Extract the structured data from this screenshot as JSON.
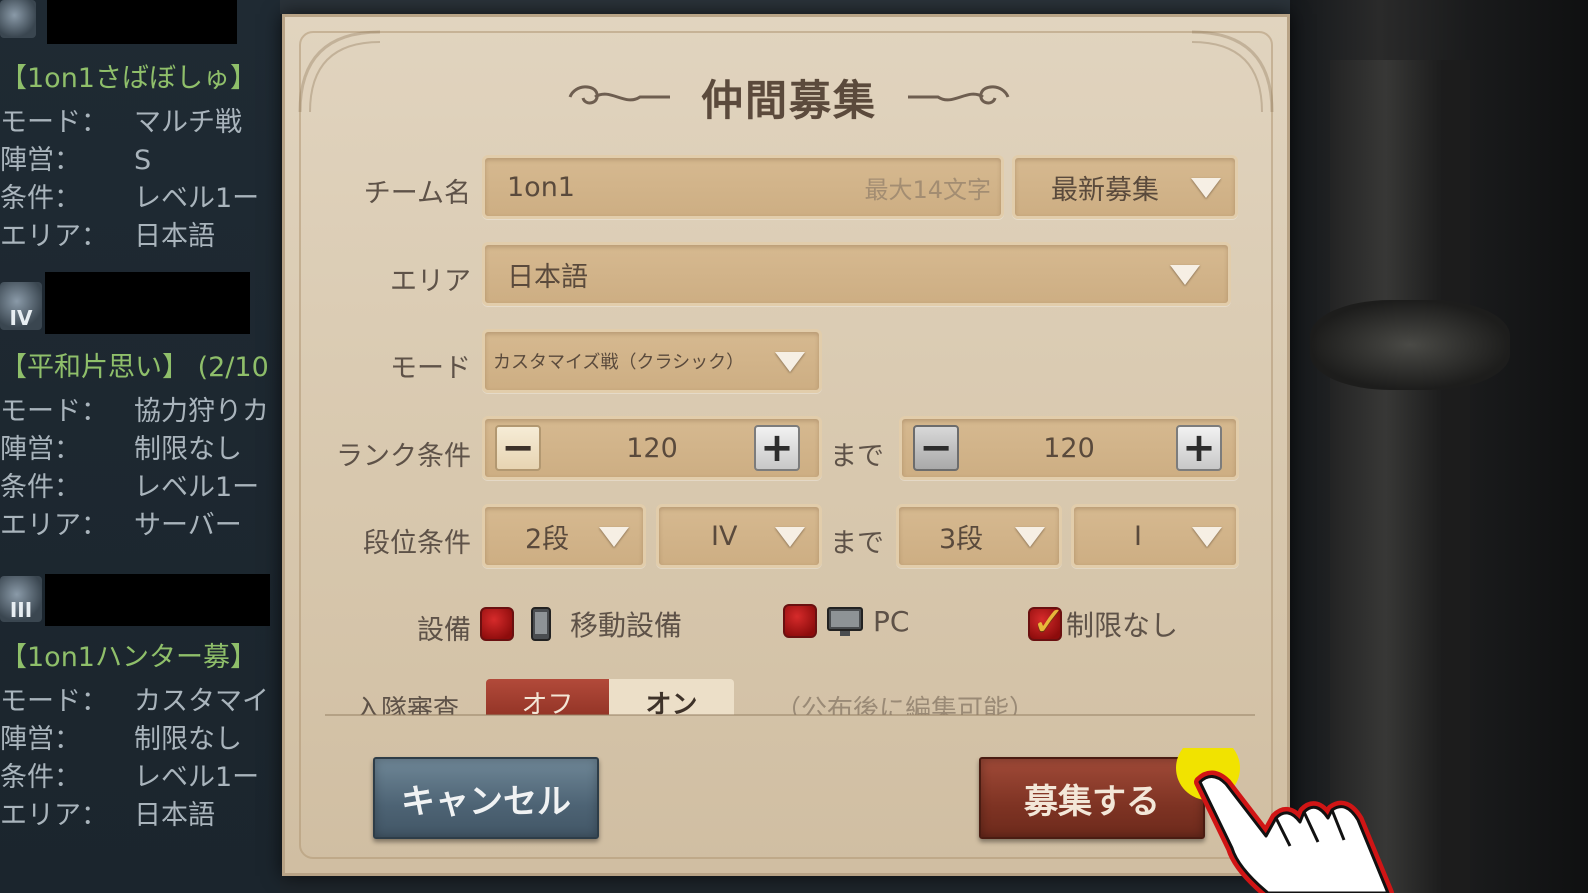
{
  "left_panel": {
    "cards": [
      {
        "rank": "",
        "team": "【1on1さばぼしゅ】",
        "rows": [
          {
            "k": "モード：",
            "v": "マルチ戦"
          },
          {
            "k": "陣営：",
            "v": "S"
          },
          {
            "k": "条件：",
            "v": "レベル1ー"
          },
          {
            "k": "エリア：",
            "v": "日本語"
          }
        ]
      },
      {
        "rank": "IV",
        "team": "【平和片思い】 (2/10",
        "rows": [
          {
            "k": "モード：",
            "v": "協力狩りカ"
          },
          {
            "k": "陣営：",
            "v": "制限なし"
          },
          {
            "k": "条件：",
            "v": "レベル1ー"
          },
          {
            "k": "エリア：",
            "v": "サーバー"
          }
        ]
      },
      {
        "rank": "III",
        "team": "【1on1ハンター募】",
        "rows": [
          {
            "k": "モード：",
            "v": "カスタマイ"
          },
          {
            "k": "陣営：",
            "v": "制限なし"
          },
          {
            "k": "条件：",
            "v": "レベル1ー"
          },
          {
            "k": "エリア：",
            "v": "日本語"
          }
        ]
      }
    ]
  },
  "dialog": {
    "title": "仲間募集",
    "team_name": {
      "label": "チーム名",
      "value": "1on1",
      "placeholder": "最大14文字",
      "sort_select": "最新募集"
    },
    "area": {
      "label": "エリア",
      "value": "日本語"
    },
    "mode": {
      "label": "モード",
      "value": "カスタマイズ戦（クラシック）"
    },
    "rank_condition": {
      "label": "ランク条件",
      "from": "120",
      "separator": "まで",
      "to": "120",
      "minus": "−",
      "plus": "+"
    },
    "tier_condition": {
      "label": "段位条件",
      "from_dan": "2段",
      "from_sub": "IV",
      "separator": "まで",
      "to_dan": "3段",
      "to_sub": "I"
    },
    "device": {
      "label": "設備",
      "options": [
        {
          "label": "移動設備",
          "icon": "phone-icon",
          "checked": false
        },
        {
          "label": "PC",
          "icon": "monitor-icon",
          "checked": false
        },
        {
          "label": "制限なし",
          "icon": "",
          "checked": true
        }
      ]
    },
    "review": {
      "label": "入隊審査",
      "off": "オフ",
      "on": "オン",
      "note": "（公布後に編集可能）"
    },
    "cancel_label": "キャンセル",
    "recruit_label": "募集する"
  },
  "colors": {
    "dialog_bg": "#d8c8ae",
    "field_bg": "#cdae83",
    "cancel_bg": "#4d6374",
    "recruit_bg": "#7e3323",
    "team_name_green": "#8fbf6a",
    "checkbox_red": "#b01818"
  }
}
